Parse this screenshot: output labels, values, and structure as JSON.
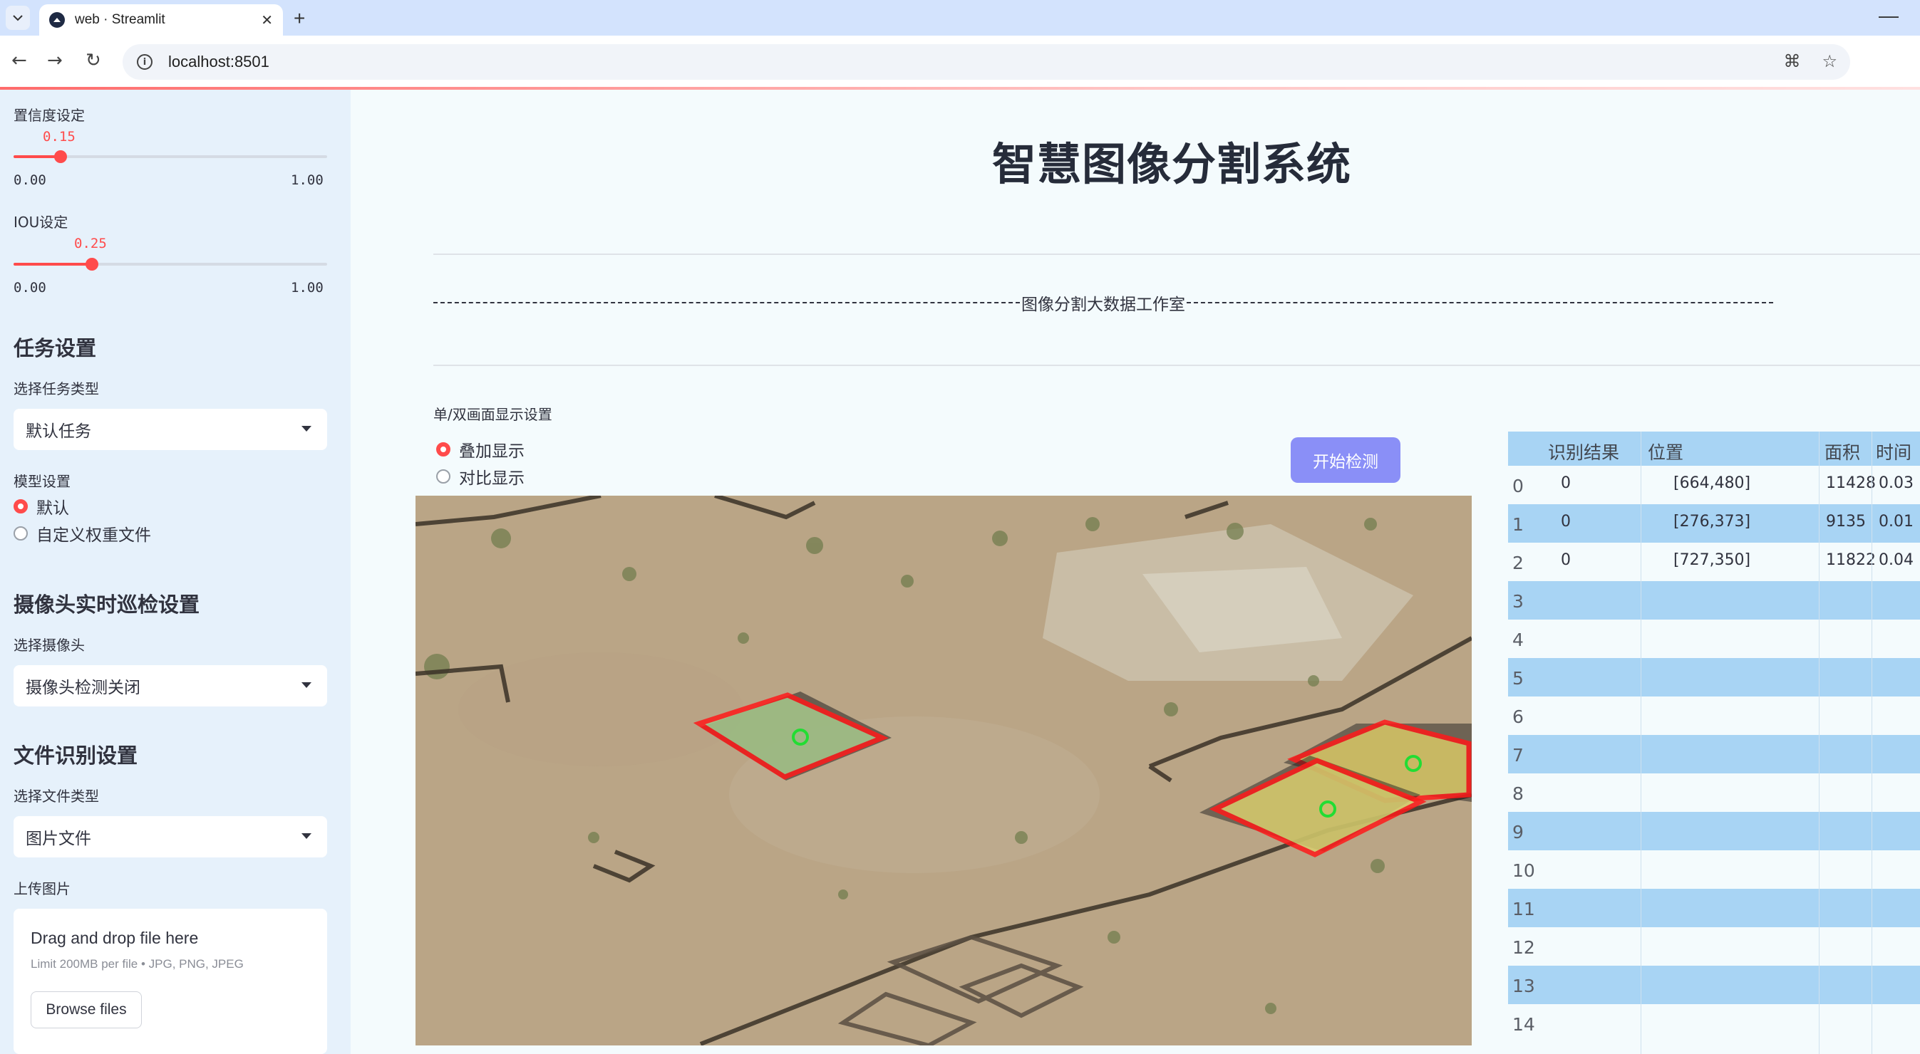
{
  "browser": {
    "tab_title": "web · Streamlit",
    "url": "localhost:8501"
  },
  "sidebar": {
    "confidence": {
      "label": "置信度设定",
      "value": "0.15",
      "min": "0.00",
      "max": "1.00",
      "fraction": 0.15
    },
    "iou": {
      "label": "IOU设定",
      "value": "0.25",
      "min": "0.00",
      "max": "1.00",
      "fraction": 0.25
    },
    "task": {
      "heading": "任务设置",
      "select_label": "选择任务类型",
      "selected": "默认任务"
    },
    "model": {
      "label": "模型设置",
      "options": [
        "默认",
        "自定义权重文件"
      ],
      "selected_index": 0
    },
    "camera": {
      "heading": "摄像头实时巡检设置",
      "select_label": "选择摄像头",
      "selected": "摄像头检测关闭"
    },
    "file": {
      "heading": "文件识别设置",
      "select_label": "选择文件类型",
      "selected": "图片文件"
    },
    "upload": {
      "label": "上传图片",
      "drop_text": "Drag and drop file here",
      "limit_text": "Limit 200MB per file • JPG, PNG, JPEG",
      "button": "Browse files"
    }
  },
  "main": {
    "title": "智慧图像分割系统",
    "studio": "图像分割大数据工作室",
    "display_label": "单/双画面显示设置",
    "display_options": [
      "叠加显示",
      "对比显示"
    ],
    "display_selected_index": 0,
    "start_button": "开始检测"
  },
  "table": {
    "columns": [
      "识别结果",
      "位置",
      "面积",
      "时间"
    ],
    "rows": [
      {
        "index": "0",
        "result": "0",
        "position": "[664,480]",
        "area": "11428",
        "time": "0.03"
      },
      {
        "index": "1",
        "result": "0",
        "position": "[276,373]",
        "area": "9135",
        "time": "0.01"
      },
      {
        "index": "2",
        "result": "0",
        "position": "[727,350]",
        "area": "11822",
        "time": "0.04"
      }
    ],
    "empty_indices": [
      "3",
      "4",
      "5",
      "6",
      "7",
      "8",
      "9",
      "10",
      "11",
      "12",
      "13",
      "14"
    ]
  },
  "colors": {
    "accent": "#ff4b4b",
    "sidebar_bg": "#e6f1fb",
    "main_bg": "#f4fbfd",
    "button": "#8a8ff7",
    "table_stripe": "#a8d4f4",
    "mask_outline": "#ff1a1a"
  }
}
